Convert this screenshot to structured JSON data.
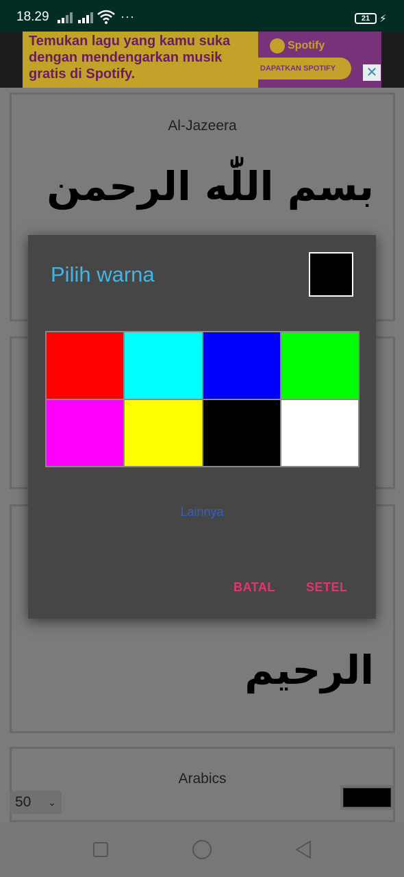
{
  "status_bar": {
    "time": "18.29",
    "battery": "21",
    "more": "···"
  },
  "ad": {
    "text": "Temukan lagu yang kamu suka dengan mendengarkan musik gratis di Spotify.",
    "brand": "Spotify",
    "cta": "DAPATKAN SPOTIFY",
    "close": "✕"
  },
  "background": {
    "cards": [
      {
        "title": "Al-Jazeera",
        "arabic": "بسم اللّٰه الرحمن"
      },
      {
        "title": "",
        "arabic": ""
      },
      {
        "title": "",
        "arabic": "الرحيم"
      },
      {
        "title": "Arabics",
        "arabic": ""
      }
    ],
    "font_size_value": "50",
    "text_color": "#000000"
  },
  "dialog": {
    "title": "Pilih warna",
    "selected_color": "#000000",
    "colors": [
      "#ff0000",
      "#00ffff",
      "#0000ff",
      "#00ff00",
      "#ff00ff",
      "#ffff00",
      "#000000",
      "#ffffff"
    ],
    "more_label": "Lainnya",
    "cancel_label": "BATAL",
    "set_label": "SETEL"
  }
}
